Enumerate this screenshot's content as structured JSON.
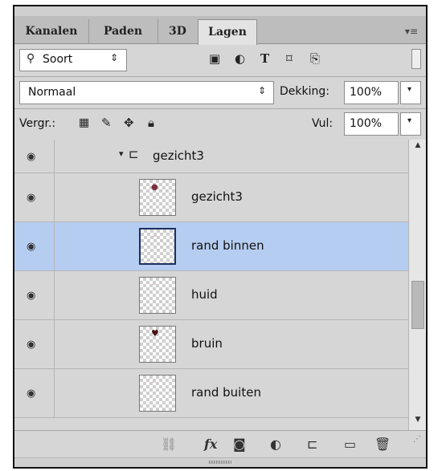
{
  "tabs": [
    "Kanalen",
    "Paden",
    "3D",
    "Lagen"
  ],
  "active_tab": "Lagen",
  "panel_menu_icon": "panel-menu-icon",
  "filter": {
    "search_icon": "search-icon",
    "kind_label": "Soort",
    "filter_icons": [
      "image-filter-icon",
      "adjustment-filter-icon",
      "type-filter-icon",
      "shape-filter-icon",
      "smart-object-filter-icon"
    ]
  },
  "blend": {
    "mode": "Normaal",
    "opacity_label": "Dekking:",
    "opacity_value": "100%"
  },
  "lock": {
    "label": "Vergr.:",
    "lock_icons": [
      "lock-transparency-icon",
      "lock-paint-icon",
      "lock-position-icon",
      "lock-all-icon"
    ],
    "fill_label": "Vul:",
    "fill_value": "100%"
  },
  "layers": [
    {
      "name": "gezicht3",
      "type": "group",
      "visible": true,
      "selected": false
    },
    {
      "name": "gezicht3",
      "type": "layer",
      "visible": true,
      "selected": false,
      "thumb_mark": "#7a3040"
    },
    {
      "name": "rand binnen",
      "type": "layer",
      "visible": true,
      "selected": true,
      "thumb_mark": "#e6b0b0"
    },
    {
      "name": "huid",
      "type": "layer",
      "visible": true,
      "selected": false,
      "thumb_mark": "#e6b0b0"
    },
    {
      "name": "bruin",
      "type": "layer",
      "visible": true,
      "selected": false,
      "thumb_mark": "#4a1010"
    },
    {
      "name": "rand buiten",
      "type": "layer",
      "visible": true,
      "selected": false,
      "thumb_mark": "#e6b0b0"
    }
  ],
  "bottom_icons": [
    "link-layers-icon",
    "fx-icon",
    "mask-icon",
    "adjustment-layer-icon",
    "new-group-icon",
    "new-layer-icon",
    "trash-icon"
  ],
  "colors": {
    "panel_bg": "#d6d6d6",
    "selected_row": "#b6cdf2",
    "tab_bar": "#bdbdbd"
  }
}
